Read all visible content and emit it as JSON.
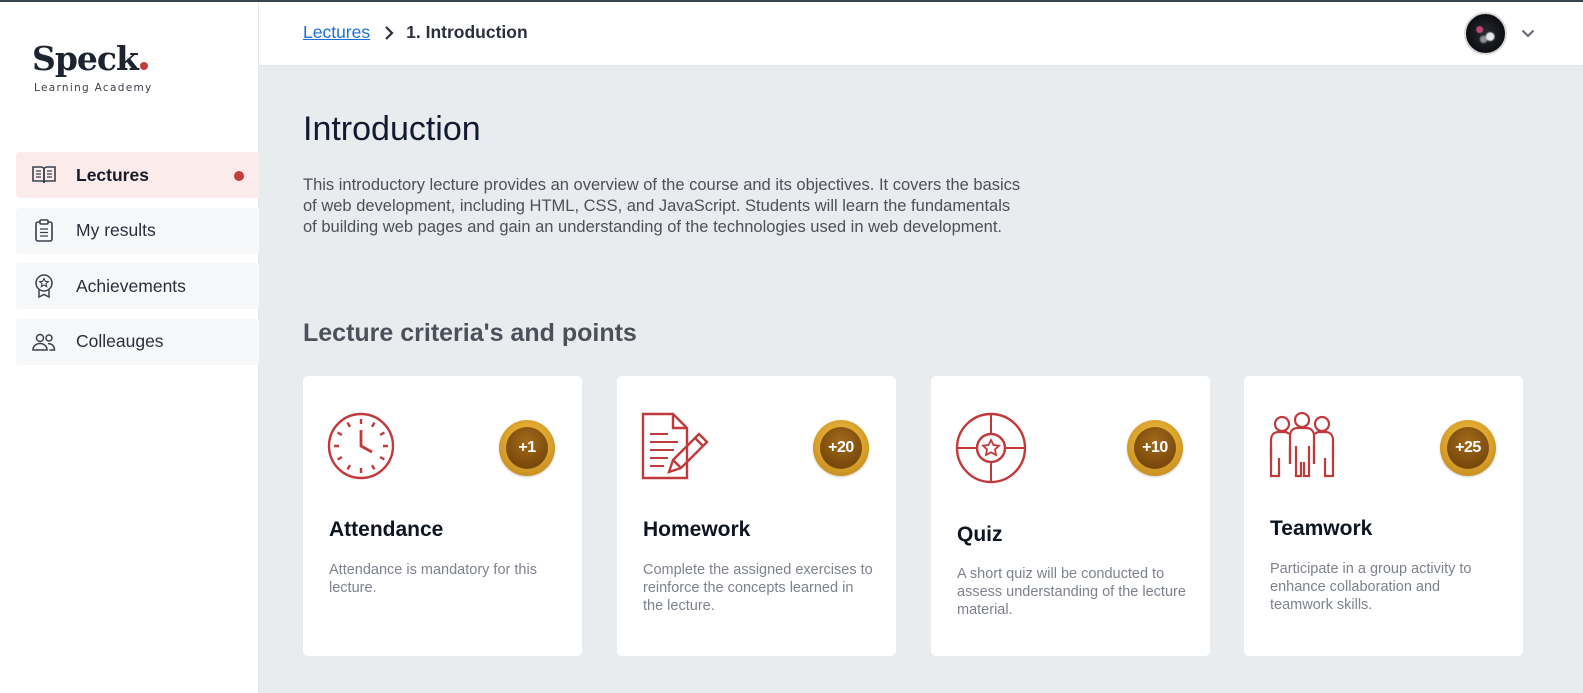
{
  "brand": {
    "name": "Speck",
    "subtitle": "Learning Academy",
    "accent": "#c63d3d"
  },
  "sidebar": {
    "items": [
      {
        "label": "Lectures",
        "icon": "book-open-icon",
        "active": true
      },
      {
        "label": "My results",
        "icon": "clipboard-icon",
        "active": false
      },
      {
        "label": "Achievements",
        "icon": "award-icon",
        "active": false
      },
      {
        "label": "Colleauges",
        "icon": "users-icon",
        "active": false
      }
    ]
  },
  "header": {
    "breadcrumb": {
      "parent": "Lectures",
      "current": "1. Introduction"
    },
    "profile": {
      "menu_icon": "chevron-down-icon"
    }
  },
  "main": {
    "title": "Introduction",
    "description": "This introductory lecture provides an overview of the course and its objectives. It covers the basics of web development, including HTML, CSS, and JavaScript. Students will learn the fundamentals of building web pages and gain an understanding of the technologies used in web development.",
    "section_title": "Lecture criteria's and points",
    "criteria": [
      {
        "title": "Attendance",
        "points": "+1",
        "icon": "clock-icon",
        "text": "Attendance is mandatory for this lecture."
      },
      {
        "title": "Homework",
        "points": "+20",
        "icon": "document-pencil-icon",
        "text": "Complete the assigned exercises to reinforce the concepts learned in the lecture."
      },
      {
        "title": "Quiz",
        "points": "+10",
        "icon": "quiz-star-icon",
        "text": "A short quiz will be conducted to assess understanding of the lecture material."
      },
      {
        "title": "Teamwork",
        "points": "+25",
        "icon": "team-icon",
        "text": "Participate in a group activity to enhance collaboration and teamwork skills."
      }
    ]
  }
}
